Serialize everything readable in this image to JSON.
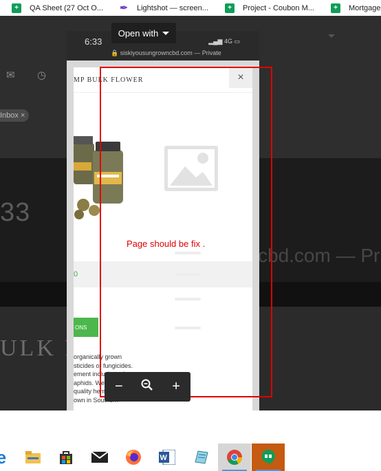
{
  "browser_tabs": [
    {
      "title": "QA Sheet (27 Oct O...",
      "icon": "sheets-icon"
    },
    {
      "title": "Lightshot — screen...",
      "icon": "lightshot-feather-icon"
    },
    {
      "title": "Project - Coubon M...",
      "icon": "sheets-icon"
    },
    {
      "title": "Mortgage",
      "icon": "sheets-icon"
    }
  ],
  "background": {
    "inbox_chip": "Inbox ×",
    "big_time": "33",
    "url_fragment": "cbd.com — Pr",
    "product_title": "ULK FL"
  },
  "phone": {
    "time": "6:33",
    "signal": "4G",
    "url": "siskiyousungrowncbd.com — Private",
    "open_with_label": "Open with",
    "page_title": "MP BULK FLOWER",
    "close_glyph": "×",
    "price_fragment": "0",
    "options_button": "ONS",
    "description_lines": [
      "organically grown",
      "sticides or fungicides.",
      "ement includes using",
      "aphids. We strive to",
      "quality hemp CBD",
      "own in Southern"
    ]
  },
  "annotation": {
    "text": "Page should be fix .",
    "color": "#e00000"
  },
  "zoom_controls": {
    "zoom_out": "−",
    "zoom_icon": "magnifier-icon",
    "zoom_in": "+"
  },
  "taskbar": {
    "apps": [
      "edge-icon",
      "file-explorer-icon",
      "store-icon",
      "mail-icon",
      "firefox-icon",
      "word-icon",
      "notepad-icon",
      "chrome-icon",
      "hangouts-icon"
    ],
    "active": "chrome-icon"
  }
}
